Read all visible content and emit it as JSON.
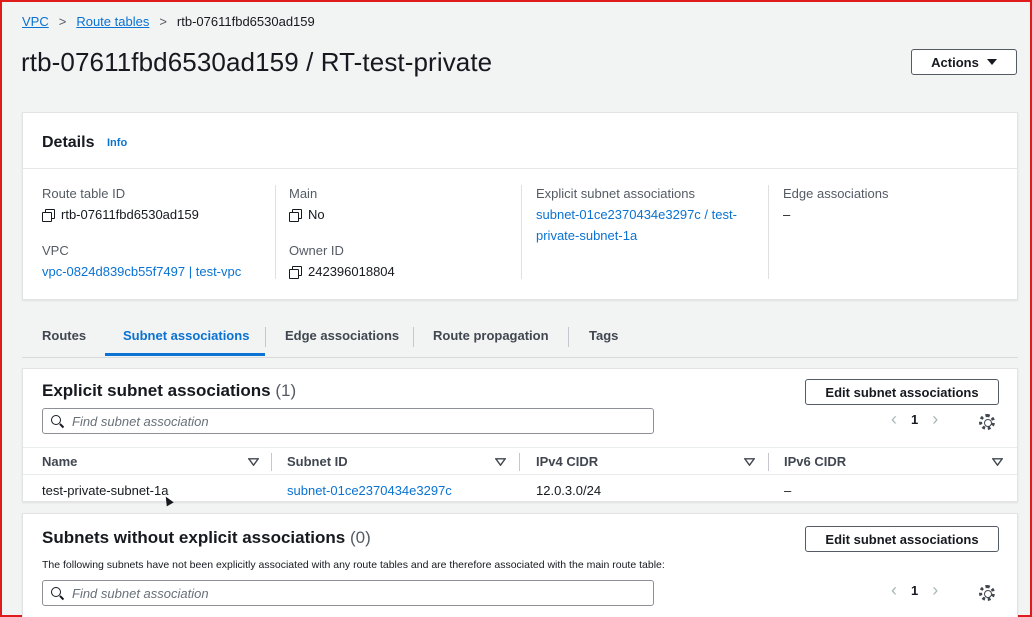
{
  "breadcrumb": {
    "items": [
      "VPC",
      "Route tables",
      "rtb-07611fbd6530ad159"
    ],
    "separator": ">"
  },
  "page_title": "rtb-07611fbd6530ad159 / RT-test-private",
  "actions_button": "Actions",
  "details": {
    "title": "Details",
    "info_link": "Info",
    "route_table_id_label": "Route table ID",
    "route_table_id": "rtb-07611fbd6530ad159",
    "vpc_label": "VPC",
    "vpc_value": "vpc-0824d839cb55f7497 | test-vpc",
    "main_label": "Main",
    "main_value": "No",
    "owner_id_label": "Owner ID",
    "owner_id": "242396018804",
    "explicit_label": "Explicit subnet associations",
    "explicit_line1": "subnet-01ce2370434e3297c / test-",
    "explicit_line2": "private-subnet-1a",
    "edge_label": "Edge associations",
    "edge_value": "–"
  },
  "tabs": [
    {
      "label": "Routes",
      "active": false
    },
    {
      "label": "Subnet associations",
      "active": true
    },
    {
      "label": "Edge associations",
      "active": false
    },
    {
      "label": "Route propagation",
      "active": false
    },
    {
      "label": "Tags",
      "active": false
    }
  ],
  "explicit_section": {
    "title": "Explicit subnet associations",
    "count": "(1)",
    "edit_button": "Edit subnet associations",
    "search_placeholder": "Find subnet association",
    "page": "1",
    "columns": [
      "Name",
      "Subnet ID",
      "IPv4 CIDR",
      "IPv6 CIDR"
    ],
    "rows": [
      {
        "name": "test-private-subnet-1a",
        "subnet_id": "subnet-01ce2370434e3297c",
        "ipv4": "12.0.3.0/24",
        "ipv6": "–"
      }
    ]
  },
  "no_explicit_section": {
    "title": "Subnets without explicit associations",
    "count": "(0)",
    "edit_button": "Edit subnet associations",
    "description": "The following subnets have not been explicitly associated with any route tables and are therefore associated with the main route table:",
    "search_placeholder": "Find subnet association",
    "page": "1"
  },
  "colors": {
    "link": "#0972d3",
    "background": "#f2f3f3",
    "frame": "#e01b1b"
  }
}
